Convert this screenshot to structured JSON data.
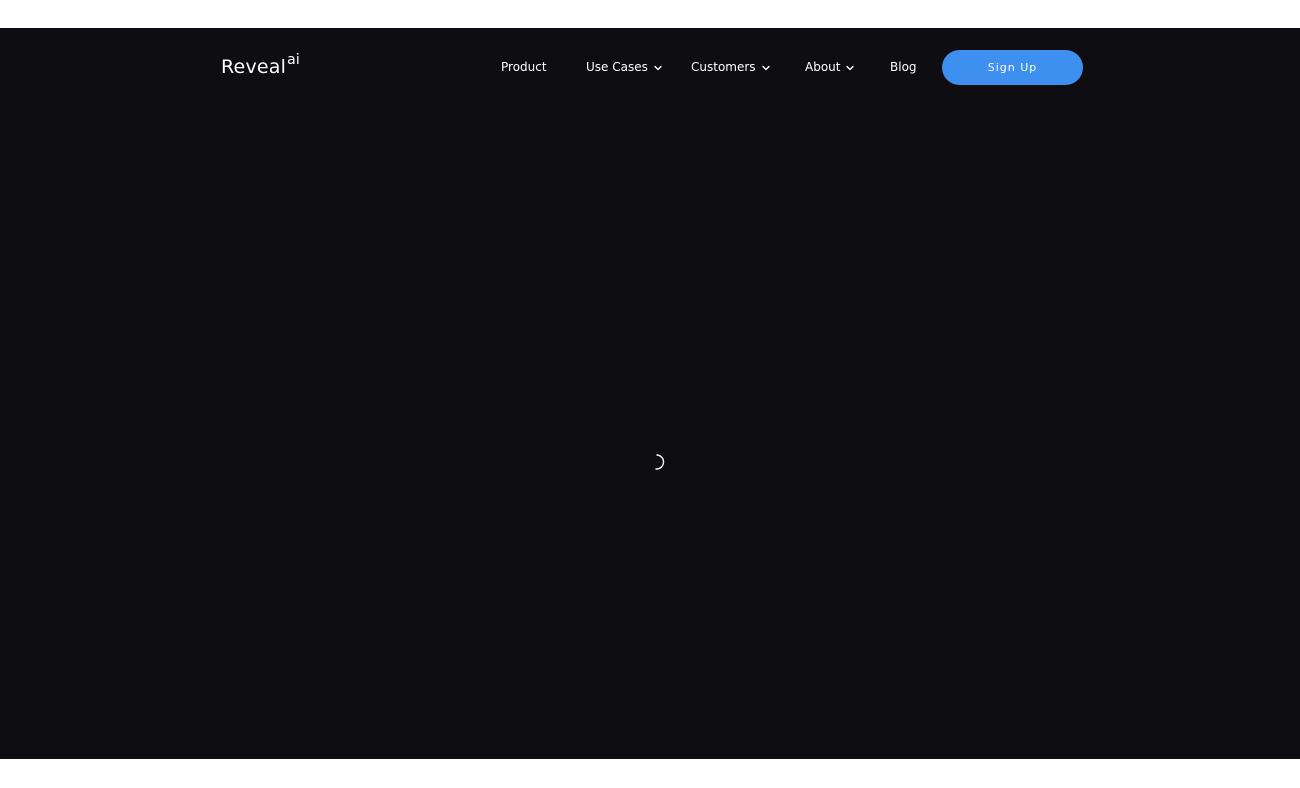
{
  "brand": {
    "name": "Reveal",
    "suffix": "ai"
  },
  "nav": {
    "items": [
      {
        "label": "Product",
        "dropdown": false
      },
      {
        "label": "Use Cases",
        "dropdown": true
      },
      {
        "label": "Customers",
        "dropdown": true
      },
      {
        "label": "About",
        "dropdown": true
      },
      {
        "label": "Blog",
        "dropdown": false
      }
    ],
    "signup_label": "Sign Up"
  },
  "colors": {
    "background": "#0d0d12",
    "accent": "#3d8ff0",
    "text": "#ffffff"
  },
  "icons": {
    "dropdown": "chevron-down-icon",
    "loading": "loading-spinner-icon"
  }
}
